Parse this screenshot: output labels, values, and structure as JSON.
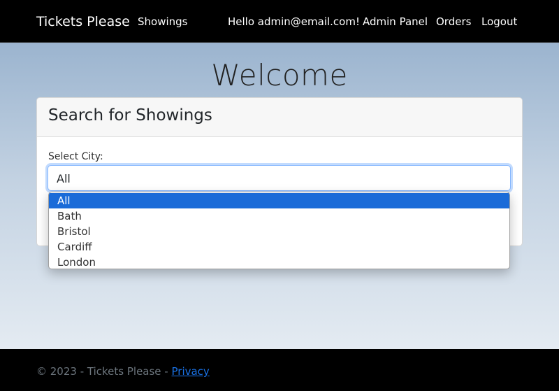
{
  "navbar": {
    "brand": "Tickets Please",
    "showings": "Showings",
    "greeting": "Hello admin@email.com!",
    "admin_panel": "Admin Panel",
    "orders": "Orders",
    "logout": "Logout"
  },
  "main": {
    "heading": "Welcome",
    "card": {
      "title": "Search for Showings",
      "city_label": "Select City:",
      "city_selected": "All",
      "city_options": [
        "All",
        "Bath",
        "Bristol",
        "Cardiff",
        "London"
      ]
    }
  },
  "footer": {
    "text": "© 2023 - Tickets Please -",
    "privacy_link": "Privacy"
  }
}
